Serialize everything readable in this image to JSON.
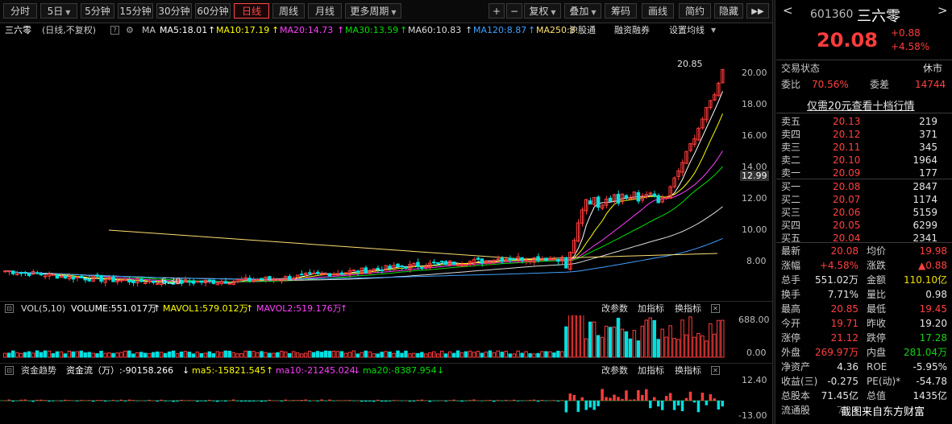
{
  "toolbar": {
    "periods": [
      "分时",
      "5日",
      "5分钟",
      "15分钟",
      "30分钟",
      "60分钟",
      "日线",
      "周线",
      "月线",
      "更多周期"
    ],
    "active_period": "日线",
    "right_items": [
      "+",
      "−",
      "复权",
      "叠加",
      "筹码",
      "画线",
      "简约",
      "隐藏"
    ],
    "collapse_icon": "double-chevron-right-icon"
  },
  "info": {
    "name": "三六零",
    "mode": "(日线,不复权)",
    "help": "?",
    "ma_label": "MA",
    "ma5": "MA5:18.01",
    "ma10": "MA10:17.19",
    "ma20": "MA20:14.73",
    "ma30": "MA30:13.59",
    "ma60": "MA60:10.83",
    "ma120": "MA120:8.87",
    "ma250": "MA250:8.",
    "hgt": "沪股通",
    "margin": "融资融券",
    "settings": "设置均线"
  },
  "main_axis": [
    "20.00",
    "18.00",
    "16.00",
    "14.00",
    "12.99",
    "12.00",
    "10.00",
    "8.00"
  ],
  "high_marker": "20.85",
  "low_marker": "6.30",
  "volume": {
    "title": "VOL(5,10)",
    "volume": "VOLUME:551.017万",
    "mavol1": "MAVOL1:579.012万",
    "mavol2": "MAVOL2:519.176万",
    "btn_params": "改参数",
    "btn_add": "加指标",
    "btn_switch": "换指标",
    "axis": [
      "688.00",
      "0.00"
    ]
  },
  "flow": {
    "title": "资金趋势",
    "flow": "资金流（万）:-90158.266",
    "ma5": "ma5:-15821.545",
    "ma10": "ma10:-21245.024",
    "ma20": "ma20:-8387.954",
    "btn_params": "改参数",
    "btn_add": "加指标",
    "btn_switch": "换指标",
    "axis": [
      "12.40",
      "-13.00"
    ]
  },
  "quote": {
    "code": "601360",
    "name": "三六零",
    "price": "20.08",
    "change": "+0.88",
    "change_pct": "+4.58%",
    "status_label": "交易状态",
    "status_value": "休市",
    "weibi_label": "委比",
    "weibi_value": "70.56%",
    "weicha_label": "委差",
    "weicha_value": "14744",
    "level2_link": "仅需20元查看十档行情",
    "asks": [
      {
        "label": "卖五",
        "price": "20.13",
        "vol": "219"
      },
      {
        "label": "卖四",
        "price": "20.12",
        "vol": "371"
      },
      {
        "label": "卖三",
        "price": "20.11",
        "vol": "345"
      },
      {
        "label": "卖二",
        "price": "20.10",
        "vol": "1964"
      },
      {
        "label": "卖一",
        "price": "20.09",
        "vol": "177"
      }
    ],
    "bids": [
      {
        "label": "买一",
        "price": "20.08",
        "vol": "2847"
      },
      {
        "label": "买二",
        "price": "20.07",
        "vol": "1174"
      },
      {
        "label": "买三",
        "price": "20.06",
        "vol": "5159"
      },
      {
        "label": "买四",
        "price": "20.05",
        "vol": "6299"
      },
      {
        "label": "买五",
        "price": "20.04",
        "vol": "2341"
      }
    ],
    "stats": [
      {
        "l1": "最新",
        "v1": "20.08",
        "c1": "red",
        "l2": "均价",
        "v2": "19.98",
        "c2": "red"
      },
      {
        "l1": "涨幅",
        "v1": "+4.58%",
        "c1": "red",
        "l2": "涨跌",
        "v2": "▲0.88",
        "c2": "red"
      },
      {
        "l1": "总手",
        "v1": "551.02万",
        "c1": "white",
        "l2": "金额",
        "v2": "110.10亿",
        "c2": "yellow"
      },
      {
        "l1": "换手",
        "v1": "7.71%",
        "c1": "white",
        "l2": "量比",
        "v2": "0.98",
        "c2": "white"
      },
      {
        "l1": "最高",
        "v1": "20.85",
        "c1": "red",
        "l2": "最低",
        "v2": "19.45",
        "c2": "red"
      },
      {
        "l1": "今开",
        "v1": "19.71",
        "c1": "red",
        "l2": "昨收",
        "v2": "19.20",
        "c2": "white"
      },
      {
        "l1": "涨停",
        "v1": "21.12",
        "c1": "red",
        "l2": "跌停",
        "v2": "17.28",
        "c2": "green"
      },
      {
        "l1": "外盘",
        "v1": "269.97万",
        "c1": "red",
        "l2": "内盘",
        "v2": "281.04万",
        "c2": "green"
      },
      {
        "l1": "净资产",
        "v1": "4.36",
        "c1": "white",
        "l2": "ROE",
        "v2": "-5.95%",
        "c2": "white"
      },
      {
        "l1": "收益(三)",
        "v1": "-0.275",
        "c1": "white",
        "l2": "PE(动)*",
        "v2": "-54.78",
        "c2": "white"
      },
      {
        "l1": "总股本",
        "v1": "71.45亿",
        "c1": "white",
        "l2": "总值",
        "v2": "1435亿",
        "c2": "white"
      },
      {
        "l1": "流通股",
        "v1": "71.4",
        "c1": "white",
        "l2": "",
        "v2": "",
        "c2": "white"
      }
    ]
  },
  "watermark": "截图来自东方财富",
  "colors": {
    "up": "#ff3c3c",
    "down": "#00e0e0",
    "ma5": "#ffffff",
    "ma10": "#ffff00",
    "ma20": "#ff40ff",
    "ma30": "#00e000",
    "ma60": "#dddddd",
    "ma120": "#40a0ff",
    "ma250": "#ffe070"
  }
}
